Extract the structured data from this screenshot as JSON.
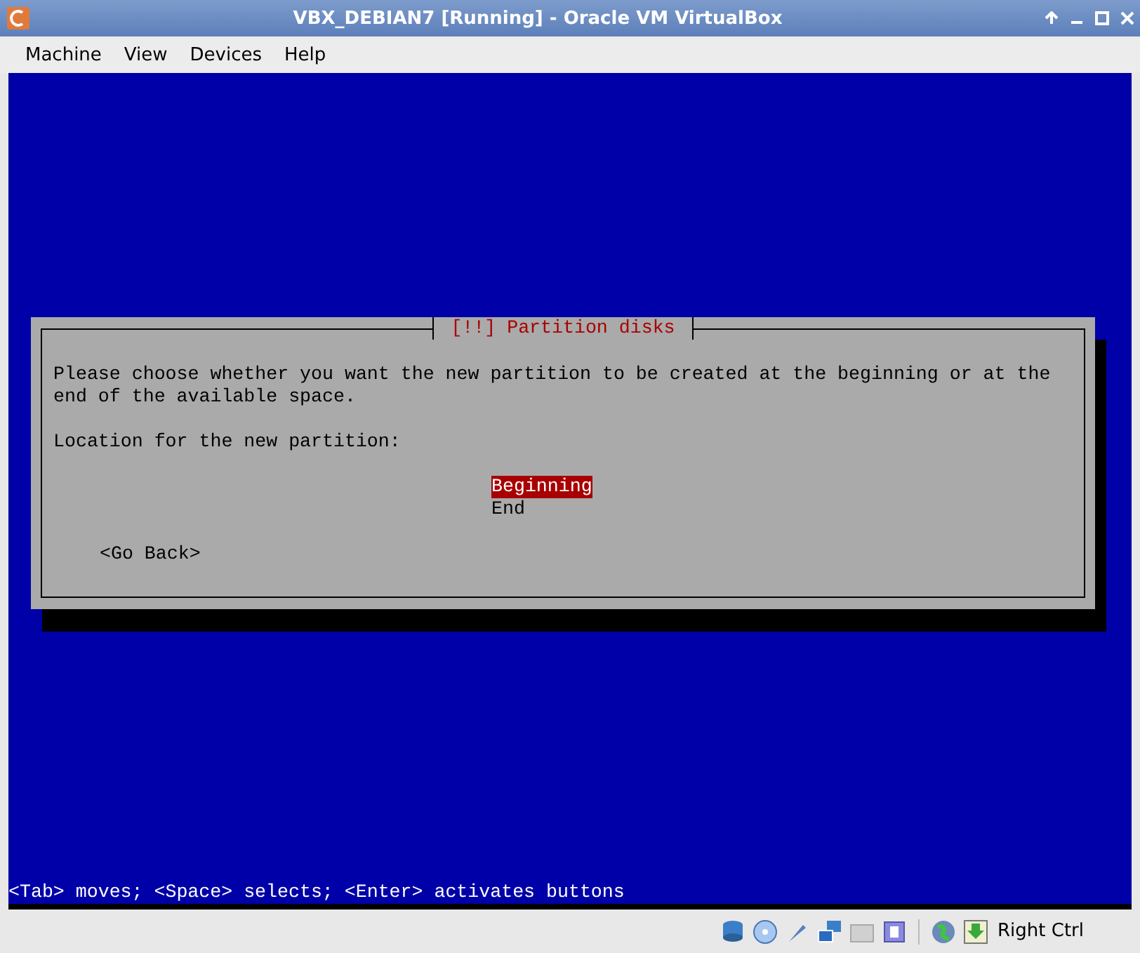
{
  "window": {
    "title": "VBX_DEBIAN7 [Running] - Oracle VM VirtualBox"
  },
  "menu": [
    "Machine",
    "View",
    "Devices",
    "Help"
  ],
  "dialog": {
    "title": "[!!] Partition disks",
    "message": "Please choose whether you want the new partition to be created at the beginning or at the end of the available space.",
    "prompt": "Location for the new partition:",
    "options": [
      {
        "label": "Beginning",
        "selected": true
      },
      {
        "label": "End",
        "selected": false
      }
    ],
    "back_button": "<Go Back>"
  },
  "help_line": "<Tab> moves; <Space> selects; <Enter> activates buttons",
  "status_bar": {
    "host_key": "Right Ctrl"
  }
}
